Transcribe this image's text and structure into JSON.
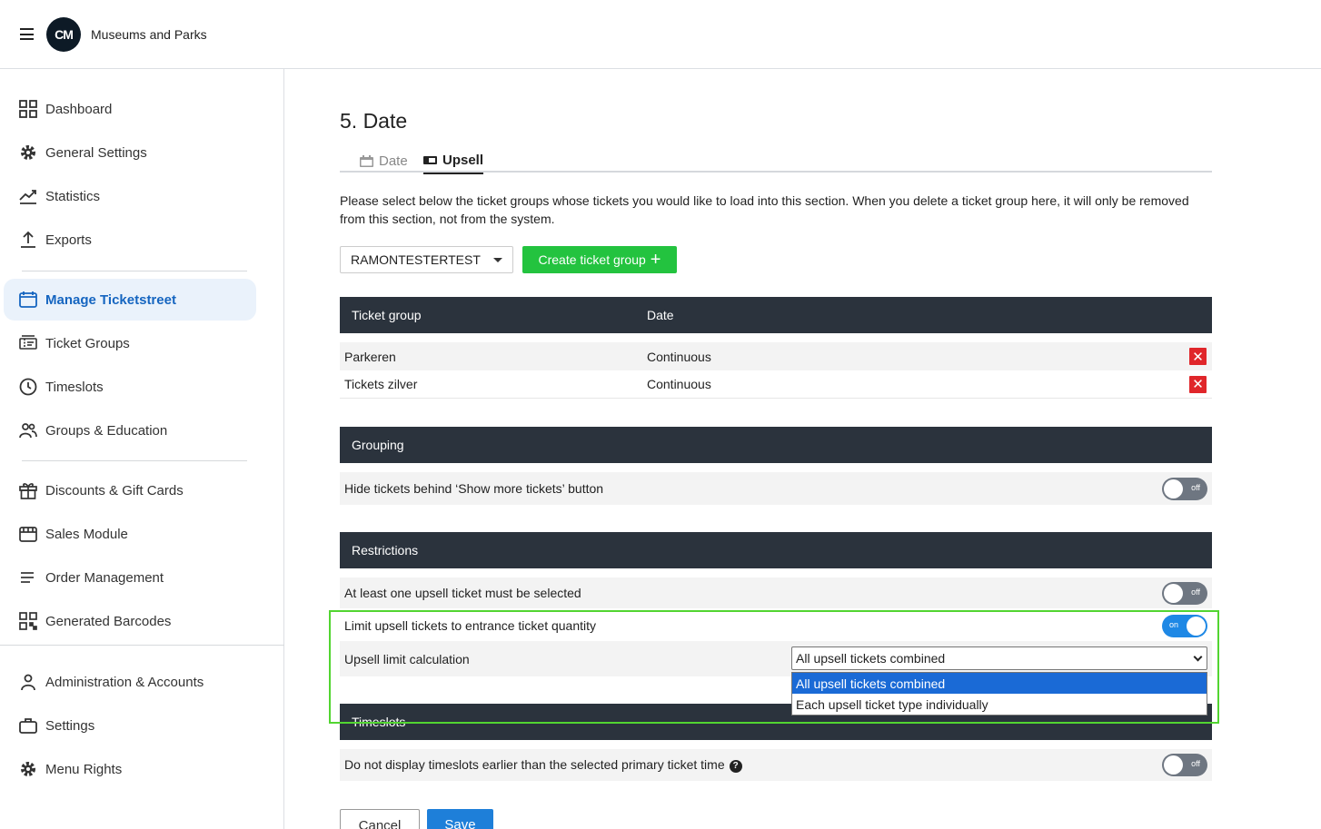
{
  "header": {
    "logo_text": "CM",
    "org_name": "Museums and Parks"
  },
  "sidebar": {
    "items": [
      {
        "label": "Dashboard",
        "icon": "grid-icon"
      },
      {
        "label": "General Settings",
        "icon": "gear-icon"
      },
      {
        "label": "Statistics",
        "icon": "trend-chart-icon"
      },
      {
        "label": "Exports",
        "icon": "upload-icon"
      },
      {
        "label": "Manage Ticketstreet",
        "icon": "calendar-window-icon",
        "active": true
      },
      {
        "label": "Ticket Groups",
        "icon": "ticket-icon"
      },
      {
        "label": "Timeslots",
        "icon": "clock-icon"
      },
      {
        "label": "Groups & Education",
        "icon": "people-icon"
      },
      {
        "label": "Discounts & Gift Cards",
        "icon": "gift-icon"
      },
      {
        "label": "Sales Module",
        "icon": "register-icon"
      },
      {
        "label": "Order Management",
        "icon": "list-icon"
      },
      {
        "label": "Generated Barcodes",
        "icon": "qr-code-icon"
      },
      {
        "label": "Administration & Accounts",
        "icon": "user-icon"
      },
      {
        "label": "Settings",
        "icon": "briefcase-icon"
      },
      {
        "label": "Menu Rights",
        "icon": "gear-icon"
      }
    ]
  },
  "main": {
    "title": "5. Date",
    "tabs": [
      {
        "label": "Date",
        "active": false
      },
      {
        "label": "Upsell",
        "active": true
      }
    ],
    "description": "Please select below the ticket groups whose tickets you would like to load into this section. When you delete a ticket group here, it will only be removed from this section, not from the system.",
    "ticket_group_select": "RAMONTESTERTEST",
    "create_button": "Create ticket group",
    "ticket_table": {
      "headers": [
        "Ticket group",
        "Date"
      ],
      "rows": [
        {
          "group": "Parkeren",
          "date": "Continuous"
        },
        {
          "group": "Tickets zilver",
          "date": "Continuous"
        }
      ]
    },
    "grouping": {
      "title": "Grouping",
      "hide_tickets_label": "Hide tickets behind ‘Show more tickets’ button",
      "hide_tickets_state": "off"
    },
    "restrictions": {
      "title": "Restrictions",
      "at_least_one_label": "At least one upsell ticket must be selected",
      "at_least_one_state": "off",
      "limit_label": "Limit upsell tickets to entrance ticket quantity",
      "limit_state": "on",
      "calc_label": "Upsell limit calculation",
      "calc_value": "All upsell tickets combined",
      "calc_options": [
        "All upsell tickets combined",
        "Each upsell ticket type individually"
      ]
    },
    "timeslots": {
      "title": "Timeslots",
      "earlier_label": "Do not display timeslots earlier than the selected primary ticket time",
      "earlier_state": "off"
    },
    "cancel_label": "Cancel",
    "save_label": "Save"
  }
}
